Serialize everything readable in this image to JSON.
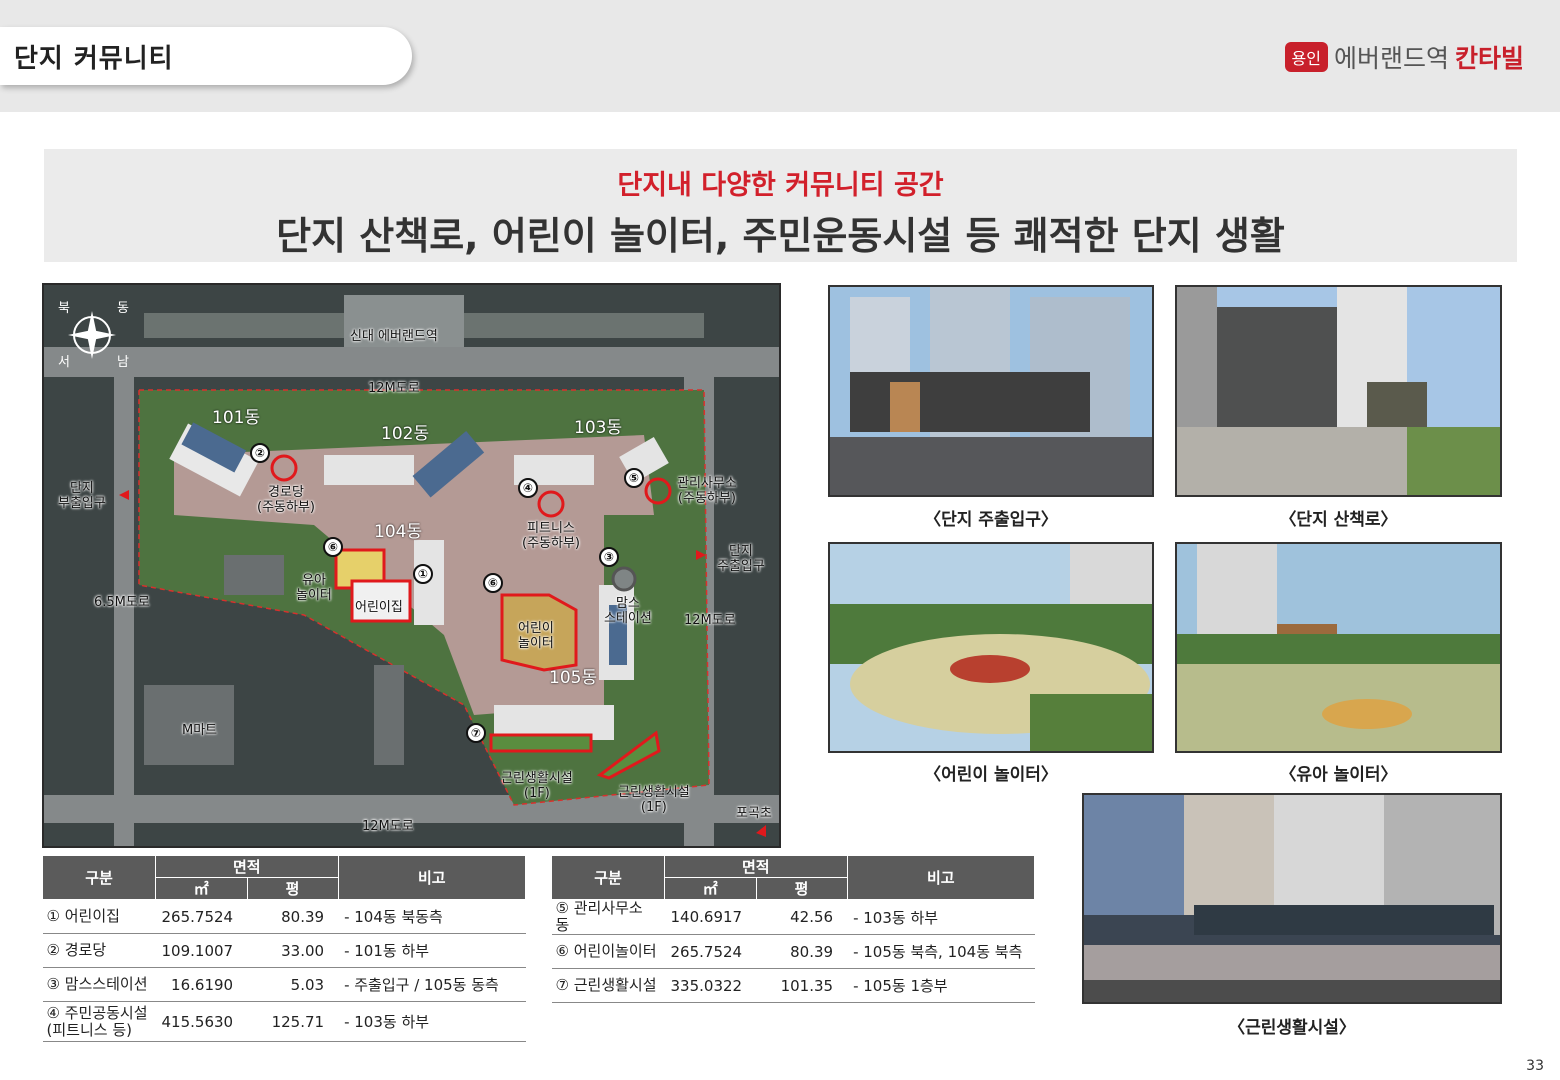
{
  "header": {
    "section_title": "단지 커뮤니티",
    "brand_badge": "용인",
    "brand_name": "에버랜드역",
    "brand_accent": "칸타빌"
  },
  "headline": {
    "subtitle": "단지내 다양한 커뮤니티 공간",
    "title": "단지 산책로, 어린이 놀이터, 주민운동시설 등 쾌적한 단지 생활"
  },
  "site_map": {
    "station": "신대 에버랜드역",
    "roads": {
      "top": "12M도로",
      "right": "12M도로",
      "left": "6.5M도로",
      "bottom": "12M도로"
    },
    "buildings": {
      "b101": "101동",
      "b102": "102동",
      "b103": "103동",
      "b104": "104동",
      "b105": "105동"
    },
    "facilities": {
      "senior": "경로당\n(주동하부)",
      "office": "관리사무소\n(주동하부)",
      "fitness": "피트니스\n(주동하부)",
      "moms": "맘스\n스테이션",
      "toddler": "유아\n놀이터",
      "daycare": "어린이집",
      "kids": "어린이\n놀이터",
      "retail1": "근린생활시설\n(1F)",
      "retail2": "근린생활시설\n(1F)"
    },
    "entrances": {
      "sub": "단지\n부출입구",
      "main": "단지\n주출입구"
    },
    "landmarks": {
      "mart": "M마트",
      "school": "포곡초"
    },
    "compass": {
      "n": "북",
      "e": "동",
      "s": "남",
      "w": "서"
    },
    "badges": [
      "①",
      "②",
      "③",
      "④",
      "⑤",
      "⑥",
      "⑥",
      "⑦"
    ]
  },
  "photos": {
    "main_entrance": "〈단지 주출입구〉",
    "walkway": "〈단지 산책로〉",
    "kids_playground": "〈어린이 놀이터〉",
    "toddler_playground": "〈유아 놀이터〉",
    "retail": "〈근린생활시설〉"
  },
  "table_headers": {
    "category": "구분",
    "area": "면적",
    "sqm": "㎡",
    "pyeong": "평",
    "note": "비고"
  },
  "table1": [
    {
      "name": "① 어린이집",
      "sqm": "265.7524",
      "pyeong": "80.39",
      "note": "- 104동 북동측"
    },
    {
      "name": "② 경로당",
      "sqm": "109.1007",
      "pyeong": "33.00",
      "note": "- 101동 하부"
    },
    {
      "name": "③ 맘스스테이션",
      "sqm": "16.6190",
      "pyeong": "5.03",
      "note": "- 주출입구 / 105동 동측"
    },
    {
      "name": "④ 주민공동시설\n(피트니스 등)",
      "sqm": "415.5630",
      "pyeong": "125.71",
      "note": "- 103동 하부"
    }
  ],
  "table2": [
    {
      "name": "⑤ 관리사무소 동",
      "sqm": "140.6917",
      "pyeong": "42.56",
      "note": "- 103동 하부"
    },
    {
      "name": "⑥ 어린이놀이터",
      "sqm": "265.7524",
      "pyeong": "80.39",
      "note": "- 105동 북측, 104동 북측"
    },
    {
      "name": "⑦ 근린생활시설",
      "sqm": "335.0322",
      "pyeong": "101.35",
      "note": "- 105동 1층부"
    }
  ],
  "page_number": "33",
  "colors": {
    "accent": "#c8202b",
    "header_band": "#e8e8e8",
    "table_header": "#5b5b5b"
  }
}
